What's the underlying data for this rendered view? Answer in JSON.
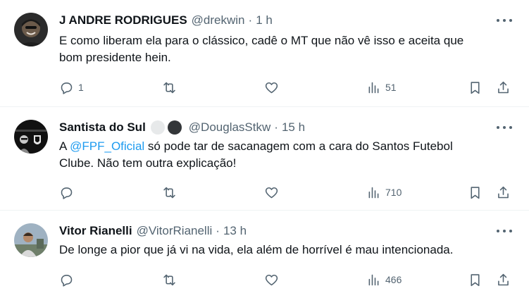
{
  "tweets": [
    {
      "name": "J ANDRE RODRIGUES",
      "handle": "@drekwin",
      "sep": "·",
      "time": "1 h",
      "text_line1": "E como liberam ela para o clássico, cadê o MT que não vê isso e aceita que",
      "text_line2": "bom presidente hein.",
      "reply_count": "1",
      "views": "51",
      "avatar_color": "#2b2b2b"
    },
    {
      "name": "Santista do Sul",
      "handle": "@DouglasStkw",
      "sep": "·",
      "time": "15 h",
      "text_prefix": "A ",
      "mention": "@FPF_Oficial",
      "text_rest": " só pode tar de sacanagem com a cara do Santos Futebol",
      "text_line2": "Clube. Não tem outra explicação!",
      "views": "710",
      "avatar_color": "#111111",
      "badge_colors": [
        "#e7e9ea",
        "#333639"
      ]
    },
    {
      "name": "Vitor Rianelli",
      "handle": "@VitorRianelli",
      "sep": "·",
      "time": "13 h",
      "text_line1": "De longe a pior que já vi na vida, ela além de horrível é mau intencionada.",
      "views": "466",
      "avatar_color": "#8a9aa8"
    }
  ],
  "icons": {
    "reply": "reply-icon",
    "retweet": "retweet-icon",
    "like": "like-icon",
    "views": "views-icon",
    "bookmark": "bookmark-icon",
    "share": "share-icon",
    "more": "more-icon"
  },
  "colors": {
    "text": "#0f1419",
    "secondary": "#536471",
    "link": "#1d9bf0",
    "divider": "#eff3f4"
  }
}
